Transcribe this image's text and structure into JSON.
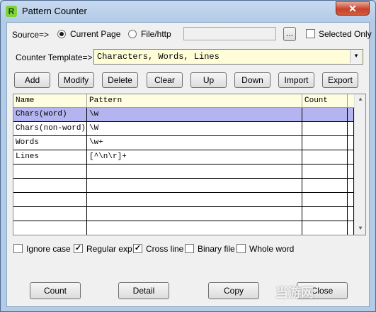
{
  "window": {
    "title": "Pattern Counter",
    "app_icon_letter": "R",
    "close_glyph": "✕"
  },
  "source": {
    "label": "Source=>",
    "options": [
      "Current Page",
      "File/http"
    ],
    "selected": "Current Page",
    "path_value": "",
    "browse_label": "...",
    "selected_only_label": "Selected Only",
    "selected_only_checked": false
  },
  "template": {
    "label": "Counter Template=>",
    "value": "Characters, Words, Lines"
  },
  "toolbar": {
    "buttons": [
      "Add",
      "Modify",
      "Delete",
      "Clear",
      "Up",
      "Down",
      "Import",
      "Export"
    ]
  },
  "table": {
    "columns": [
      "Name",
      "Pattern",
      "Count"
    ],
    "rows": [
      {
        "name": "Chars(word)",
        "pattern": "\\w",
        "count": ""
      },
      {
        "name": "Chars(non-word)",
        "pattern": "\\W",
        "count": ""
      },
      {
        "name": "Words",
        "pattern": "\\w+",
        "count": ""
      },
      {
        "name": "Lines",
        "pattern": "[^\\n\\r]+",
        "count": ""
      },
      {
        "name": "",
        "pattern": "",
        "count": ""
      },
      {
        "name": "",
        "pattern": "",
        "count": ""
      },
      {
        "name": "",
        "pattern": "",
        "count": ""
      },
      {
        "name": "",
        "pattern": "",
        "count": ""
      },
      {
        "name": "",
        "pattern": "",
        "count": ""
      }
    ],
    "selected_row": 0
  },
  "options": [
    {
      "label": "Ignore case",
      "checked": false
    },
    {
      "label": "Regular exp",
      "checked": true
    },
    {
      "label": "Cross line",
      "checked": true
    },
    {
      "label": "Binary file",
      "checked": false
    },
    {
      "label": "Whole word",
      "checked": false
    }
  ],
  "actions": {
    "count": "Count",
    "detail": "Detail",
    "copy": "Copy",
    "close": "Close"
  },
  "watermark": "当游网",
  "colors": {
    "selected_row": "#b4b4f0",
    "template_bg": "#fffed8",
    "header_bg": "#fffde0",
    "close_button": "#c7432b"
  }
}
